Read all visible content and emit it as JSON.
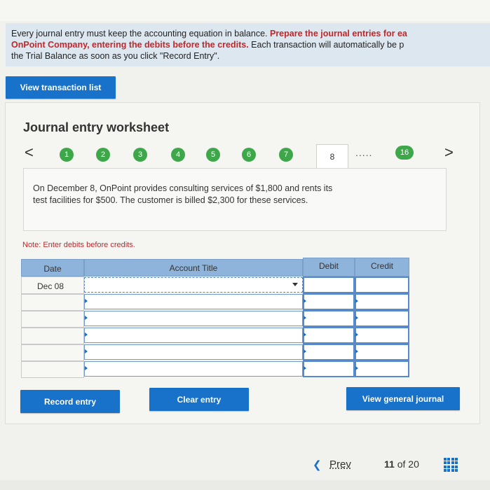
{
  "instructions": {
    "line1_prefix": "Every journal entry must keep the accounting equation in balance. ",
    "line1_bold": "Prepare the journal entries for ea",
    "line2_bold": "OnPoint Company, entering the debits before the credits.",
    "line2_suffix": " Each transaction will automatically be p",
    "line3": "the Trial Balance as soon as you click \"Record Entry\"."
  },
  "buttons": {
    "view_transaction_list": "View transaction list",
    "record_entry": "Record entry",
    "clear_entry": "Clear entry",
    "view_general_journal": "View general journal"
  },
  "worksheet": {
    "title": "Journal entry worksheet",
    "prev_arrow": "<",
    "next_arrow": ">",
    "steps": [
      "1",
      "2",
      "3",
      "4",
      "5",
      "6",
      "7"
    ],
    "current_step": "8",
    "ellipsis": ".....",
    "last_step": "16",
    "description_line1": "On December 8, OnPoint provides consulting services of $1,800 and rents its",
    "description_line2": "test facilities for $500. The customer is billed $2,300 for these services.",
    "note": "Note: Enter debits before credits."
  },
  "table": {
    "headers": {
      "date": "Date",
      "account": "Account Title",
      "debit": "Debit",
      "credit": "Credit"
    },
    "rows": [
      {
        "date": "Dec 08",
        "account": "",
        "debit": "",
        "credit": ""
      },
      {
        "date": "",
        "account": "",
        "debit": "",
        "credit": ""
      },
      {
        "date": "",
        "account": "",
        "debit": "",
        "credit": ""
      },
      {
        "date": "",
        "account": "",
        "debit": "",
        "credit": ""
      },
      {
        "date": "",
        "account": "",
        "debit": "",
        "credit": ""
      },
      {
        "date": "",
        "account": "",
        "debit": "",
        "credit": ""
      }
    ]
  },
  "pager": {
    "prev_label": "Prev",
    "current": "11",
    "of_label": "of",
    "total": "20"
  },
  "colors": {
    "accent": "#1872c9",
    "step_done": "#3ea74a",
    "emphasis": "#c0282b",
    "header_blue": "#8fb4dc"
  }
}
